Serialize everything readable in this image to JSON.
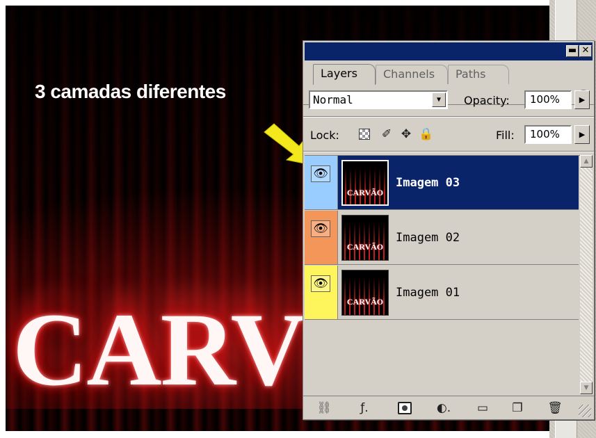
{
  "canvas": {
    "caption": "3 camadas diferentes",
    "artwork_text": "CARV"
  },
  "panel": {
    "title_buttons": {
      "minimize": "▬",
      "close": "✕"
    },
    "tabs": [
      {
        "label": "Layers",
        "active": true
      },
      {
        "label": "Channels",
        "active": false
      },
      {
        "label": "Paths",
        "active": false
      }
    ],
    "menu_icon": "▶",
    "blend_mode": "Normal",
    "opacity_label": "Opacity:",
    "opacity_value": "100%",
    "lock_label": "Lock:",
    "lock_icons": [
      "transparency-lock-icon",
      "brush-icon",
      "move-icon",
      "padlock-icon"
    ],
    "fill_label": "Fill:",
    "fill_value": "100%",
    "layers": [
      {
        "name": "Imagem 03",
        "selected": true,
        "eye_color": "#99ccff",
        "thumb_text": "CARVÃO"
      },
      {
        "name": "Imagem 02",
        "selected": false,
        "eye_color": "#f4955a",
        "thumb_text": "CARVÃO"
      },
      {
        "name": "Imagem 01",
        "selected": false,
        "eye_color": "#fef45c",
        "thumb_text": "CARVÃO"
      }
    ],
    "bottom_icons": [
      "link-icon",
      "fx-icon",
      "layer-mask-icon",
      "adjustment-layer-icon",
      "folder-icon",
      "new-layer-icon",
      "trash-icon"
    ]
  },
  "colors": {
    "selected_row": "#0a246a",
    "panel_bg": "#d4d0c8",
    "arrow": "#f2e81c"
  }
}
